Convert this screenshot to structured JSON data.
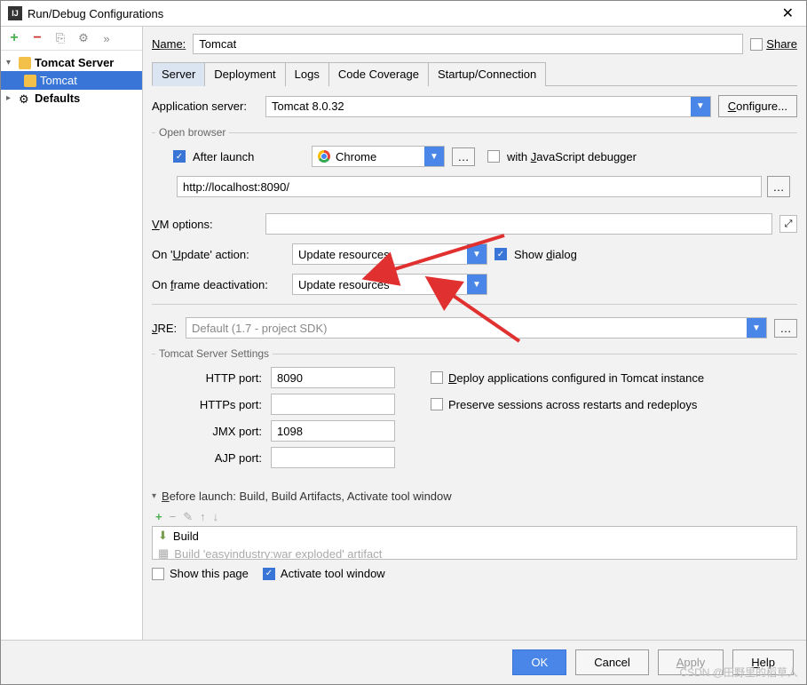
{
  "titlebar": {
    "title": "Run/Debug Configurations",
    "icon_text": "IJ"
  },
  "toolbar": {
    "add": "+",
    "remove": "−",
    "copy": "⎘",
    "settings": "⚙",
    "arrows": "»"
  },
  "tree": {
    "tomcat_server": "Tomcat Server",
    "tomcat_child": "Tomcat",
    "defaults": "Defaults"
  },
  "name": {
    "label": "Name:",
    "value": "Tomcat"
  },
  "share": {
    "label": "Share"
  },
  "tabs": [
    "Server",
    "Deployment",
    "Logs",
    "Code Coverage",
    "Startup/Connection"
  ],
  "app_server": {
    "label": "Application server:",
    "value": "Tomcat 8.0.32",
    "configure": "Configure..."
  },
  "open_browser": {
    "legend": "Open browser",
    "after_launch": "After launch",
    "browser": "Chrome",
    "with_js": "with JavaScript debugger",
    "url": "http://localhost:8090/"
  },
  "vm": {
    "label": "VM options:",
    "value": ""
  },
  "update": {
    "label": "On 'Update' action:",
    "value": "Update resources",
    "show_dialog": "Show dialog"
  },
  "frame": {
    "label": "On frame deactivation:",
    "value": "Update resources"
  },
  "jre": {
    "label": "JRE:",
    "value": "Default (1.7 - project SDK)"
  },
  "tomcat_settings": {
    "legend": "Tomcat Server Settings",
    "http_label": "HTTP port:",
    "http_value": "8090",
    "https_label": "HTTPs port:",
    "https_value": "",
    "jmx_label": "JMX port:",
    "jmx_value": "1098",
    "ajp_label": "AJP port:",
    "ajp_value": "",
    "deploy": "Deploy applications configured in Tomcat instance",
    "preserve": "Preserve sessions across restarts and redeploys"
  },
  "before_launch": {
    "title": "Before launch: Build, Build Artifacts, Activate tool window",
    "add": "+",
    "remove": "−",
    "edit": "✎",
    "up": "↑",
    "down": "↓",
    "item1": "Build",
    "item2": "Build 'easyindustry:war exploded' artifact",
    "show_page": "Show this page",
    "activate": "Activate tool window"
  },
  "footer": {
    "ok": "OK",
    "cancel": "Cancel",
    "apply": "Apply",
    "help": "Help"
  },
  "watermark": "CSDN @田野里的稻草人"
}
